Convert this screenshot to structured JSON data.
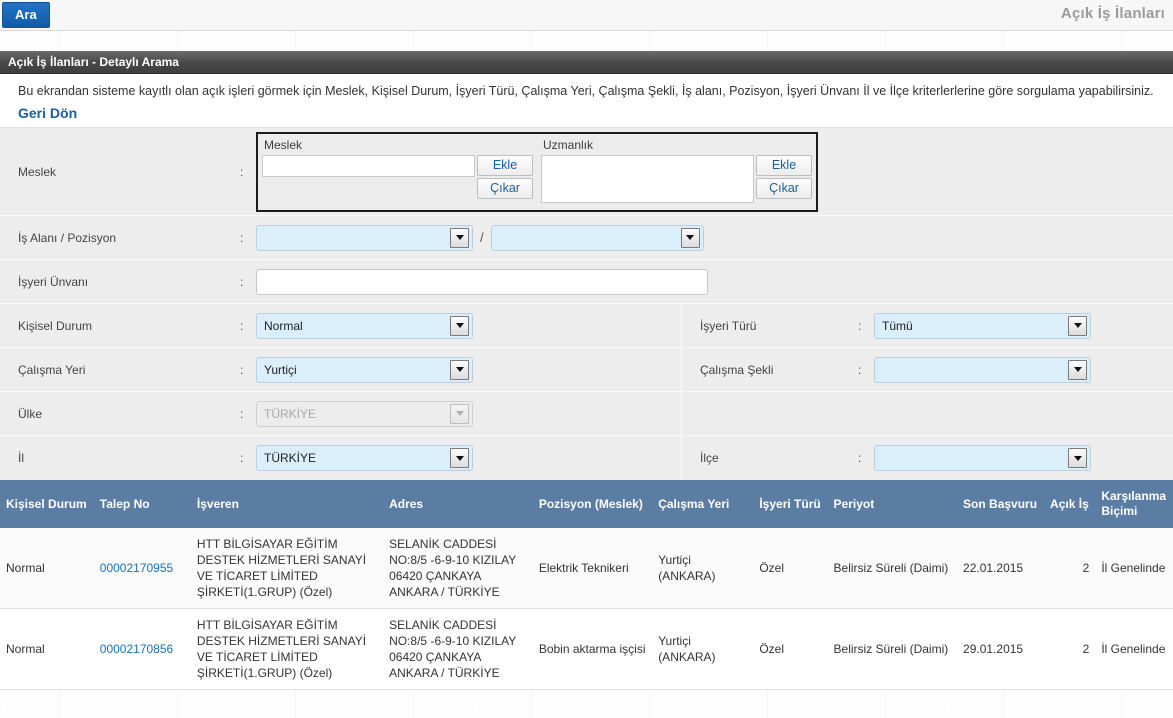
{
  "topbar": {
    "search_button_label": "Ara",
    "app_title": "Açık İş İlanları"
  },
  "panel": {
    "title": "Açık İş İlanları - Detaylı Arama",
    "description": "Bu ekrandan sisteme kayıtlı olan açık işleri görmek için Meslek, Kişisel Durum, İşyeri Türü, Çalışma Yeri, Çalışma Şekli, İş alanı, Pozisyon, İşyeri Ünvanı İl ve İlçe kriterlerlerine göre sorgulama yapabilirsiniz.",
    "back_link": "Geri Dön"
  },
  "form": {
    "meslek": {
      "label": "Meslek",
      "colon": ":",
      "meslek_caption": "Meslek",
      "uzmanlik_caption": "Uzmanlık",
      "add_label": "Ekle",
      "remove_label": "Çıkar",
      "meslek_value": "",
      "uzmanlik_value": ""
    },
    "is_alani": {
      "label": "İş Alanı / Pozisyon",
      "colon": ":",
      "separator": "/",
      "alan_value": "",
      "pozisyon_value": ""
    },
    "isyeri_unvani": {
      "label": "İşyeri Ünvanı",
      "colon": ":",
      "value": "",
      "placeholder": ""
    },
    "kisisel_durum": {
      "label": "Kişisel Durum",
      "colon": ":",
      "value": "Normal"
    },
    "isyeri_turu": {
      "label": "İşyeri Türü",
      "colon": ":",
      "value": "Tümü"
    },
    "calisma_yeri": {
      "label": "Çalışma Yeri",
      "colon": ":",
      "value": "Yurtiçi"
    },
    "calisma_sekli": {
      "label": "Çalışma Şekli",
      "colon": ":",
      "value": ""
    },
    "ulke": {
      "label": "Ülke",
      "colon": ":",
      "value": "TÜRKİYE",
      "disabled": true
    },
    "il": {
      "label": "İl",
      "colon": ":",
      "value": "TÜRKİYE"
    },
    "ilce": {
      "label": "İlçe",
      "colon": ":",
      "value": ""
    }
  },
  "results": {
    "columns": [
      "Kişisel Durum",
      "Talep No",
      "İşveren",
      "Adres",
      "Pozisyon (Meslek)",
      "Çalışma Yeri",
      "İşyeri Türü",
      "Periyot",
      "Son Başvuru",
      "Açık İş",
      "Karşılanma Biçimi"
    ],
    "rows": [
      {
        "kisisel_durum": "Normal",
        "talep_no": "00002170955",
        "isveren": "HTT BİLGİSAYAR EĞİTİM DESTEK HİZMETLERİ SANAYİ VE TİCARET LİMİTED ŞİRKETİ(1.GRUP) (Özel)",
        "adres": "SELANİK CADDESİ NO:8/5 -6-9-10 KIZILAY 06420 ÇANKAYA ANKARA / TÜRKİYE",
        "pozisyon": "Elektrik Teknikeri",
        "calisma_yeri": "Yurtiçi (ANKARA)",
        "isyeri_turu": "Özel",
        "periyot": "Belirsiz Süreli (Daimi)",
        "son_basvuru": "22.01.2015",
        "acik_is": "2",
        "karsilanma_bicimi": "İl Genelinde"
      },
      {
        "kisisel_durum": "Normal",
        "talep_no": "00002170856",
        "isveren": "HTT BİLGİSAYAR EĞİTİM DESTEK HİZMETLERİ SANAYİ VE TİCARET LİMİTED ŞİRKETİ(1.GRUP) (Özel)",
        "adres": "SELANİK CADDESİ NO:8/5 -6-9-10 KIZILAY 06420 ÇANKAYA ANKARA / TÜRKİYE",
        "pozisyon": "Bobin aktarma işçisi",
        "calisma_yeri": "Yurtiçi (ANKARA)",
        "isyeri_turu": "Özel",
        "periyot": "Belirsiz Süreli (Daimi)",
        "son_basvuru": "29.01.2015",
        "acik_is": "2",
        "karsilanma_bicimi": "İl Genelinde"
      }
    ]
  },
  "colors": {
    "accent_blue": "#1767b5",
    "table_header": "#5b7da3",
    "panel_title_dark": "#484848",
    "field_blue": "#dbeefb",
    "link_blue": "#1b5e9e"
  }
}
